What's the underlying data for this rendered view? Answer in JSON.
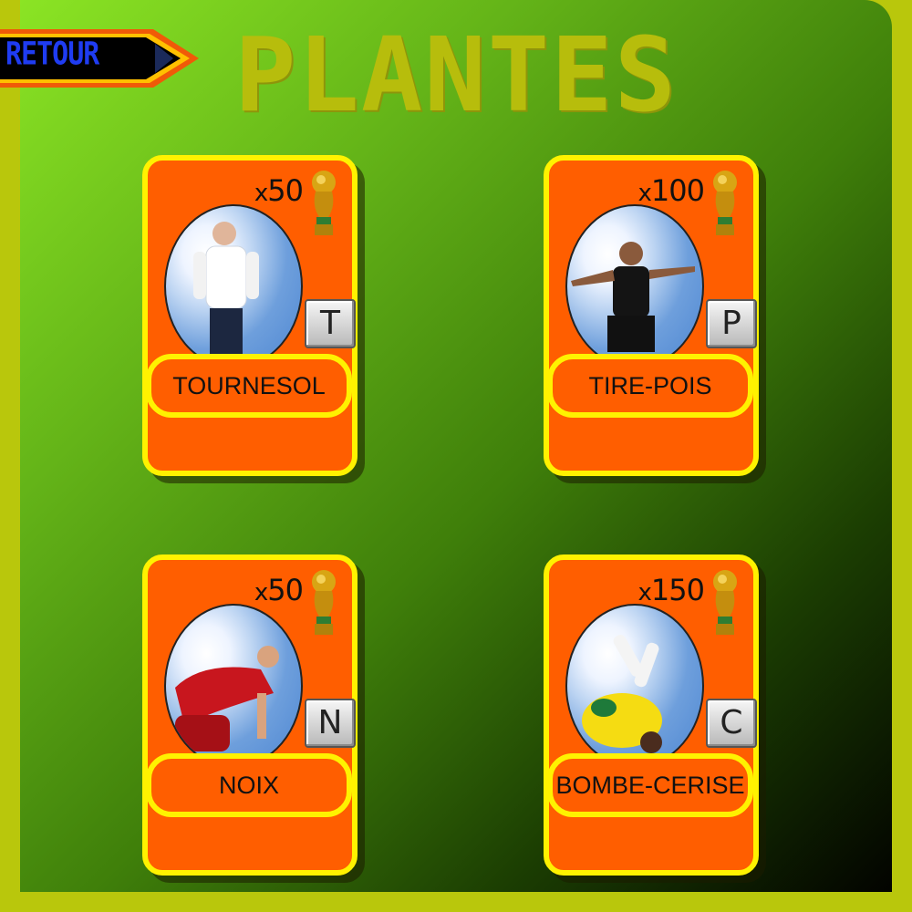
{
  "screen": {
    "title": "PLANTES",
    "back_label": "RETOUR"
  },
  "currency_icon": "world-cup-trophy-icon",
  "cards": [
    {
      "name": "TOURNESOL",
      "cost_prefix": "x",
      "cost": "50",
      "key": "T"
    },
    {
      "name": "TIRE-POIS",
      "cost_prefix": "x",
      "cost": "100",
      "key": "P"
    },
    {
      "name": "NOIX",
      "cost_prefix": "x",
      "cost": "50",
      "key": "N"
    },
    {
      "name": "BOMBE-CERISE",
      "cost_prefix": "x",
      "cost": "150",
      "key": "C"
    }
  ],
  "colors": {
    "card_fill": "#ff5e00",
    "card_border": "#fff200",
    "title": "#b7bd0c",
    "back_label": "#1f3cf2"
  }
}
